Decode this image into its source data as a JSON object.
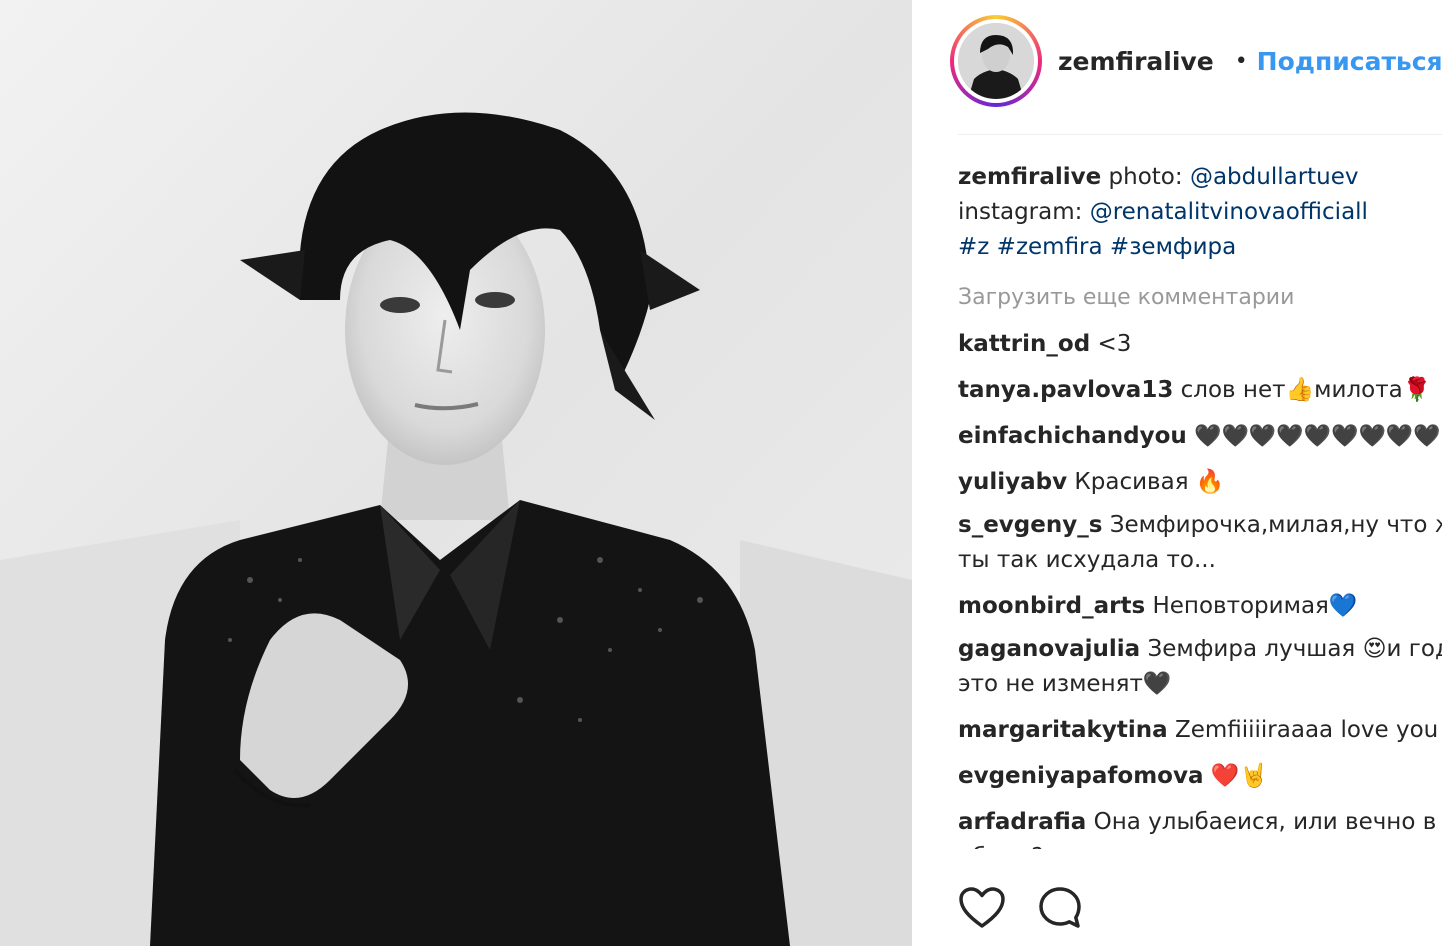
{
  "post": {
    "photo_icon": "portrait-photo"
  },
  "header": {
    "username": "zemfiralive",
    "verified_icon": "verified-badge-icon",
    "separator": "•",
    "follow_label": "Подписаться"
  },
  "caption": {
    "username": "zemfiralive",
    "text_1": " photo: ",
    "link_1": "@abdullartuev",
    "text_2": "instagram: ",
    "link_2": "@renatalitvinovaofficiall",
    "tag_1": "#z",
    "tag_2": "#zemfira",
    "tag_3": "#земфира"
  },
  "load_more": "Загрузить еще комментарии",
  "comments": [
    {
      "user": "kattrin_od",
      "text": "<3"
    },
    {
      "user": "tanya.pavlova13",
      "text": "слов нет👍милота🌹"
    },
    {
      "user": "einfachichandyou",
      "text": "🖤🖤🖤🖤🖤🖤🖤🖤🖤"
    },
    {
      "user": "yuliyabv",
      "text": "Красивая 🔥"
    },
    {
      "user": "s_evgeny_s",
      "text": "Земфирочка,милая,ну что ж ты так исхудала то..."
    },
    {
      "user": "moonbird_arts",
      "text": "Неповторимая💙"
    },
    {
      "user": "gaganovajulia",
      "text": "Земфира лучшая 😍и год это не изменят🖤"
    },
    {
      "user": "margaritakytina",
      "text": "Zemfiiiiiraaaa love you"
    },
    {
      "user": "evgeniyapafomova",
      "text": "❤️🤘"
    },
    {
      "user": "arfadrafia",
      "text": "Она улыбаеися, или вечно в обиде?"
    }
  ],
  "actions": {
    "like_icon": "heart-icon",
    "comment_icon": "comment-icon"
  },
  "colors": {
    "link": "#003569",
    "follow": "#3897f0",
    "muted": "#999999",
    "text": "#262626"
  }
}
